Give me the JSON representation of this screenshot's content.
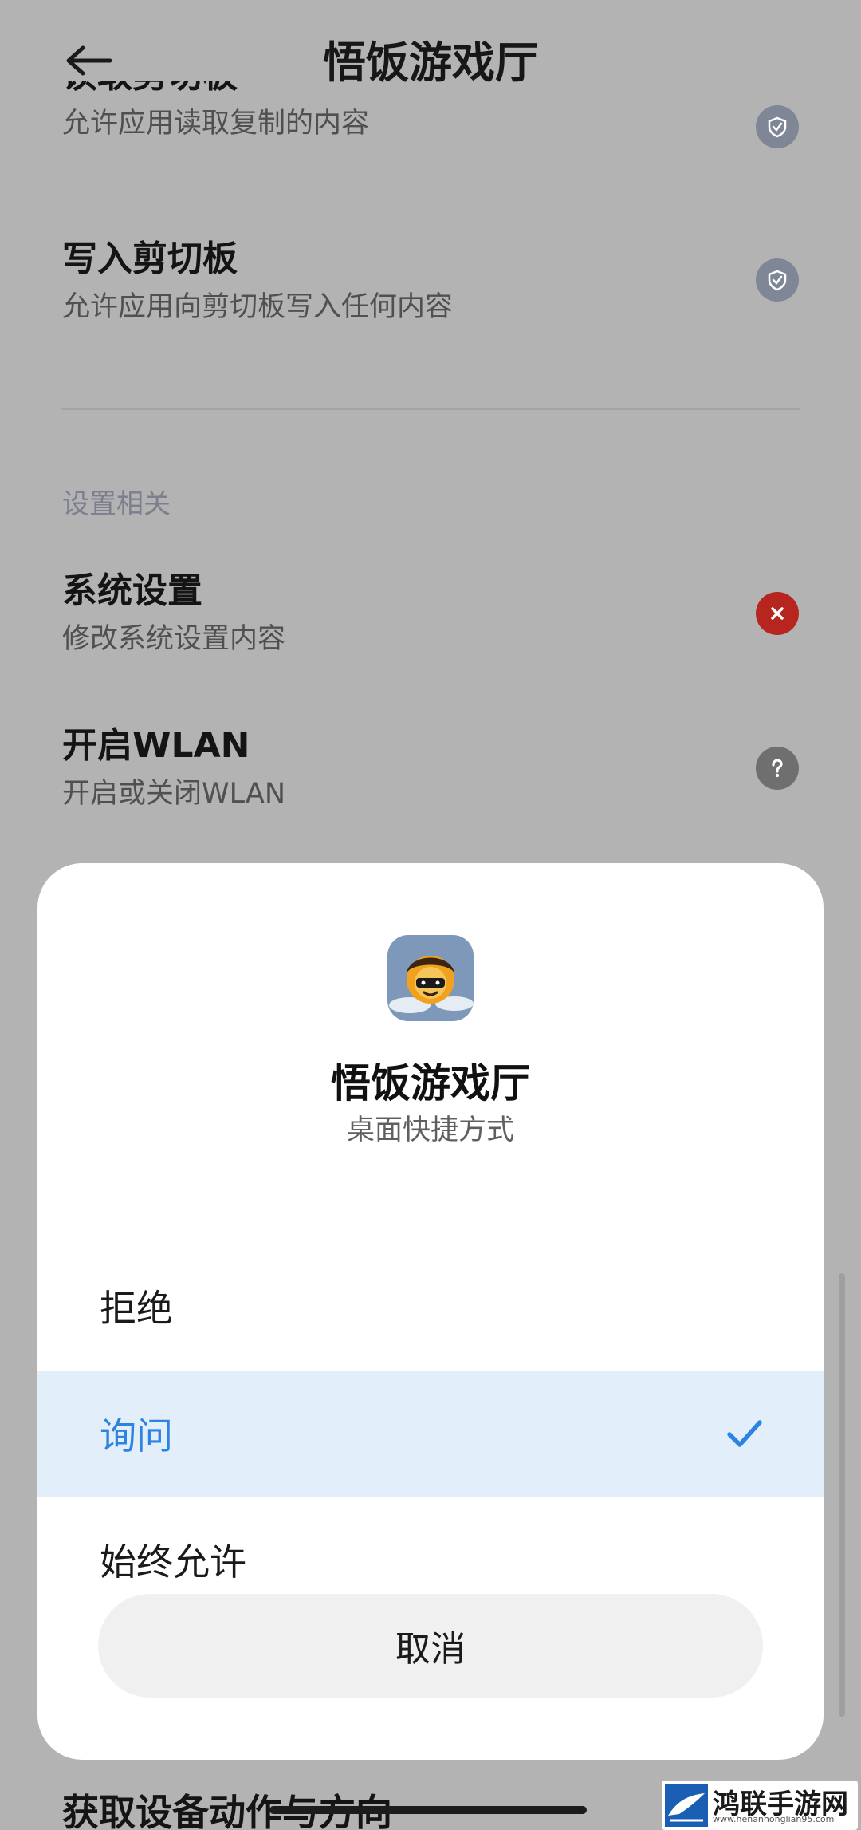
{
  "header": {
    "title": "悟饭游戏厅",
    "back_icon": "arrow-left-icon"
  },
  "permissions_top": [
    {
      "name": "读取剪切板",
      "desc": "允许应用读取复制的内容",
      "status": "allowed"
    },
    {
      "name": "写入剪切板",
      "desc": "允许应用向剪切板写入任何内容",
      "status": "allowed"
    }
  ],
  "section_settings": {
    "label": "设置相关",
    "items": [
      {
        "name": "系统设置",
        "desc": "修改系统设置内容",
        "status": "denied"
      },
      {
        "name": "开启WLAN",
        "desc": "开启或关闭WLAN",
        "status": "ask"
      }
    ]
  },
  "dialog": {
    "app_name": "悟饭游戏厅",
    "subtitle": "桌面快捷方式",
    "options": [
      {
        "label": "拒绝",
        "selected": false
      },
      {
        "label": "询问",
        "selected": true
      },
      {
        "label": "始终允许",
        "selected": false
      }
    ],
    "cancel_label": "取消"
  },
  "bottom_item": {
    "name": "获取设备动作与方向"
  },
  "watermark": {
    "text": "鸿联手游网",
    "url": "www.henanhonglian95.com"
  },
  "colors": {
    "accent": "#2d83e0",
    "selected_bg": "#e3eefb",
    "denied": "#b6261f",
    "allowed": "#7f8797",
    "ask": "#6f6f6f",
    "scrim": "#b3b3b3"
  }
}
